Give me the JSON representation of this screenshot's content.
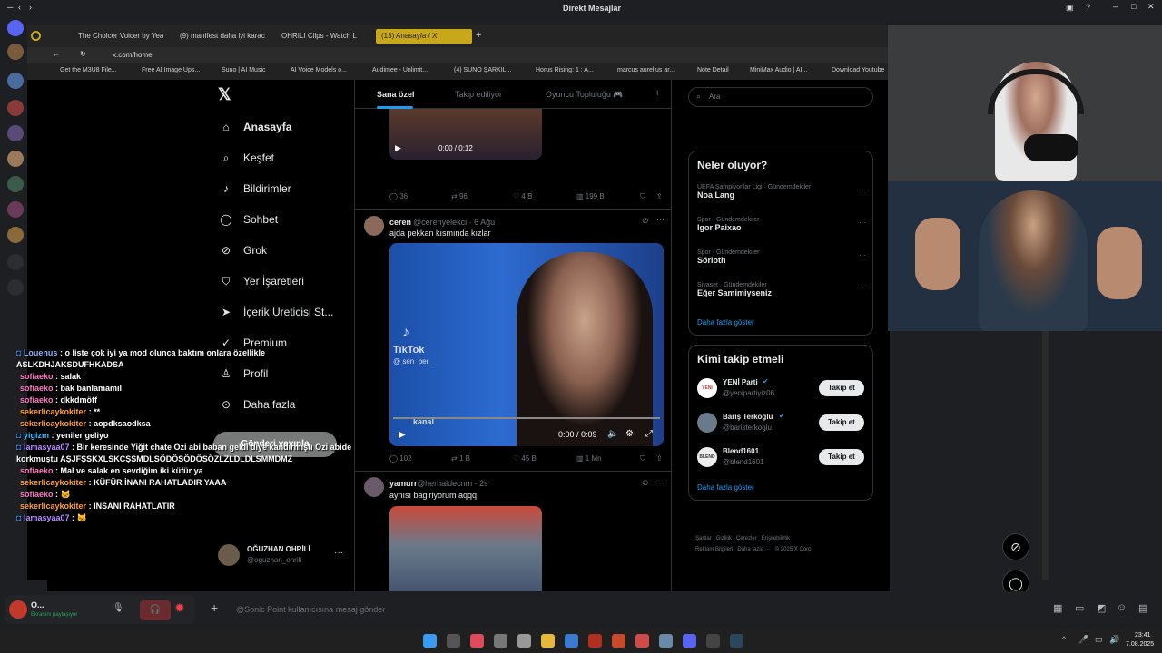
{
  "window": {
    "title": "Direkt Mesajlar"
  },
  "browser": {
    "tabs": [
      {
        "label": "The Choicer Voicer by Yea"
      },
      {
        "label": "(9) manifest daha iyi karac"
      },
      {
        "label": "OHRILI Clips - Watch L"
      },
      {
        "label": "(13) Anasayfa / X"
      }
    ],
    "url": "x.com/home",
    "bookmarks": [
      "Get the M3U8 File...",
      "Free AI Image Ups...",
      "Suno | AI Music",
      "AI Voice Models o...",
      "Audimee - Unlimit...",
      "(4) SUNO ŞARKIL...",
      "Horus Rising: 1 : A...",
      "marcus aurelius ar...",
      "Note Detail",
      "MiniMax Audio | AI...",
      "Download Youtube"
    ]
  },
  "x": {
    "nav": [
      {
        "label": "Anasayfa",
        "icon": "home-icon",
        "glyph": "⌂"
      },
      {
        "label": "Keşfet",
        "icon": "search-icon",
        "glyph": "⌕"
      },
      {
        "label": "Bildirimler",
        "icon": "bell-icon",
        "glyph": "♪"
      },
      {
        "label": "Sohbet",
        "icon": "chat-icon",
        "glyph": "◯"
      },
      {
        "label": "Grok",
        "icon": "grok-icon",
        "glyph": "⊘"
      },
      {
        "label": "Yer İşaretleri",
        "icon": "bookmark-icon",
        "glyph": "⛉"
      },
      {
        "label": "İçerik Üreticisi St...",
        "icon": "rocket-icon",
        "glyph": "➤"
      },
      {
        "label": "Premium",
        "icon": "premium-icon",
        "glyph": "✓"
      },
      {
        "label": "Profil",
        "icon": "profile-icon",
        "glyph": "♙"
      },
      {
        "label": "Daha fazla",
        "icon": "more-icon",
        "glyph": "⊙"
      }
    ],
    "post_button": "Gönderi yayınla",
    "account": {
      "name": "OĞUZHAN OHRİLİ",
      "handle": "@oguzhan_ohrili"
    },
    "feed_tabs": [
      "Sana özel",
      "Takip ediliyor",
      "Oyuncu Topluluğu 🎮"
    ],
    "post0": {
      "time": "0:00 / 0:12",
      "replies": "36",
      "reposts": "96",
      "likes": "4 B",
      "views": "199 B"
    },
    "post1": {
      "name": "ceren",
      "handle": "@cerenyelekci · 6 Ağu",
      "text": "ajda pekkan kısmında kızlar",
      "video_time": "0:00 / 0:09",
      "watermark": "TikTok",
      "watermark_user": "@ sen_ber_",
      "channel": "kanal",
      "replies": "102",
      "reposts": "1 B",
      "likes": "45 B",
      "views": "1 Mn"
    },
    "post2": {
      "name": "yamurr",
      "handle": "@herhaldecnm · 2s",
      "text": "aynısı bagiriyorum aqqq"
    },
    "search_placeholder": "Ara",
    "trends_title": "Neler oluyor?",
    "trends": [
      {
        "meta": "UEFA Şampiyonlar Ligi · Gündemdekiler",
        "name": "Noa Lang"
      },
      {
        "meta": "Spor · Gündemdekiler",
        "name": "Igor Paixao"
      },
      {
        "meta": "Spor · Gündemdekiler",
        "name": "Sörloth"
      },
      {
        "meta": "Siyaset · Gündemdekiler",
        "name": "Eğer Samimiyseniz"
      }
    ],
    "show_more": "Daha fazla göster",
    "who_title": "Kimi takip etmeli",
    "who": [
      {
        "name": "YENİ Parti",
        "handle": "@yenipartiyiz06",
        "avatar": "YENİ"
      },
      {
        "name": "Barış Terkoğlu",
        "handle": "@baristerkoglu",
        "avatar": ""
      },
      {
        "name": "Blend1601",
        "handle": "@blend1601",
        "avatar": "BLEND"
      }
    ],
    "follow_label": "Takip et",
    "footer": [
      "Şartlar",
      "Gizlilik",
      "Çerezler",
      "Erişilebilirlik",
      "Reklam Bilgileri",
      "Daha fazla ···",
      "© 2025 X Corp."
    ]
  },
  "chat": [
    {
      "user": "Louenus",
      "color": "#8ab4f8",
      "badge": true,
      "msg": ": o liste çok iyi ya mod olunca baktım onlara özellikle ASLKDHJAKSDUFHKADSA"
    },
    {
      "user": "sofiaeko",
      "color": "#ff7ac6",
      "msg": ": salak"
    },
    {
      "user": "sofiaeko",
      "color": "#ff7ac6",
      "msg": ": bak banlamamıl"
    },
    {
      "user": "sofiaeko",
      "color": "#ff7ac6",
      "msg": ": dkkdmöff"
    },
    {
      "user": "sekerlicaykokiter",
      "color": "#ff9e3d",
      "msg": ": **"
    },
    {
      "user": "sekerlicaykokiter",
      "color": "#ff9e3d",
      "msg": ": aopdksaodksa"
    },
    {
      "user": "yigizm",
      "color": "#2fc0ff",
      "badge": true,
      "msg": ": yeniler geliyo"
    },
    {
      "user": "lamasyaa07",
      "color": "#b88cff",
      "badge": true,
      "msg": ": Bir keresinde Yiğit chate Ozi abi baban geldi diye kandırmıştı Ozi abide korkmuştu AŞJFŞSKXLSKCŞSMDLSÖDÖSÖDÖSÖZLZLDLDLSMMDMZ"
    },
    {
      "user": "sofiaeko",
      "color": "#ff7ac6",
      "msg": ": Mal ve salak en sevdiğim iki küfür ya"
    },
    {
      "user": "sekerlicaykokiter",
      "color": "#ff9e3d",
      "msg": ": KÜFÜR İNANI RAHATLADIR YAAA"
    },
    {
      "user": "sofiaeko",
      "color": "#ff7ac6",
      "msg": ": 🐱"
    },
    {
      "user": "sekerlicaykokiter",
      "color": "#ff9e3d",
      "msg": ": İNSANI RAHATLATIR"
    },
    {
      "user": "lamasyaa07",
      "color": "#b88cff",
      "badge": true,
      "msg": ": 🐱"
    }
  ],
  "discord": {
    "user_initial": "O...",
    "status": "Ekranını paylaşıyor",
    "message_placeholder": "@Sonic Point kullanıcısına mesaj gönder"
  },
  "taskbar": {
    "time": "23:41",
    "date": "7.08.2025"
  }
}
